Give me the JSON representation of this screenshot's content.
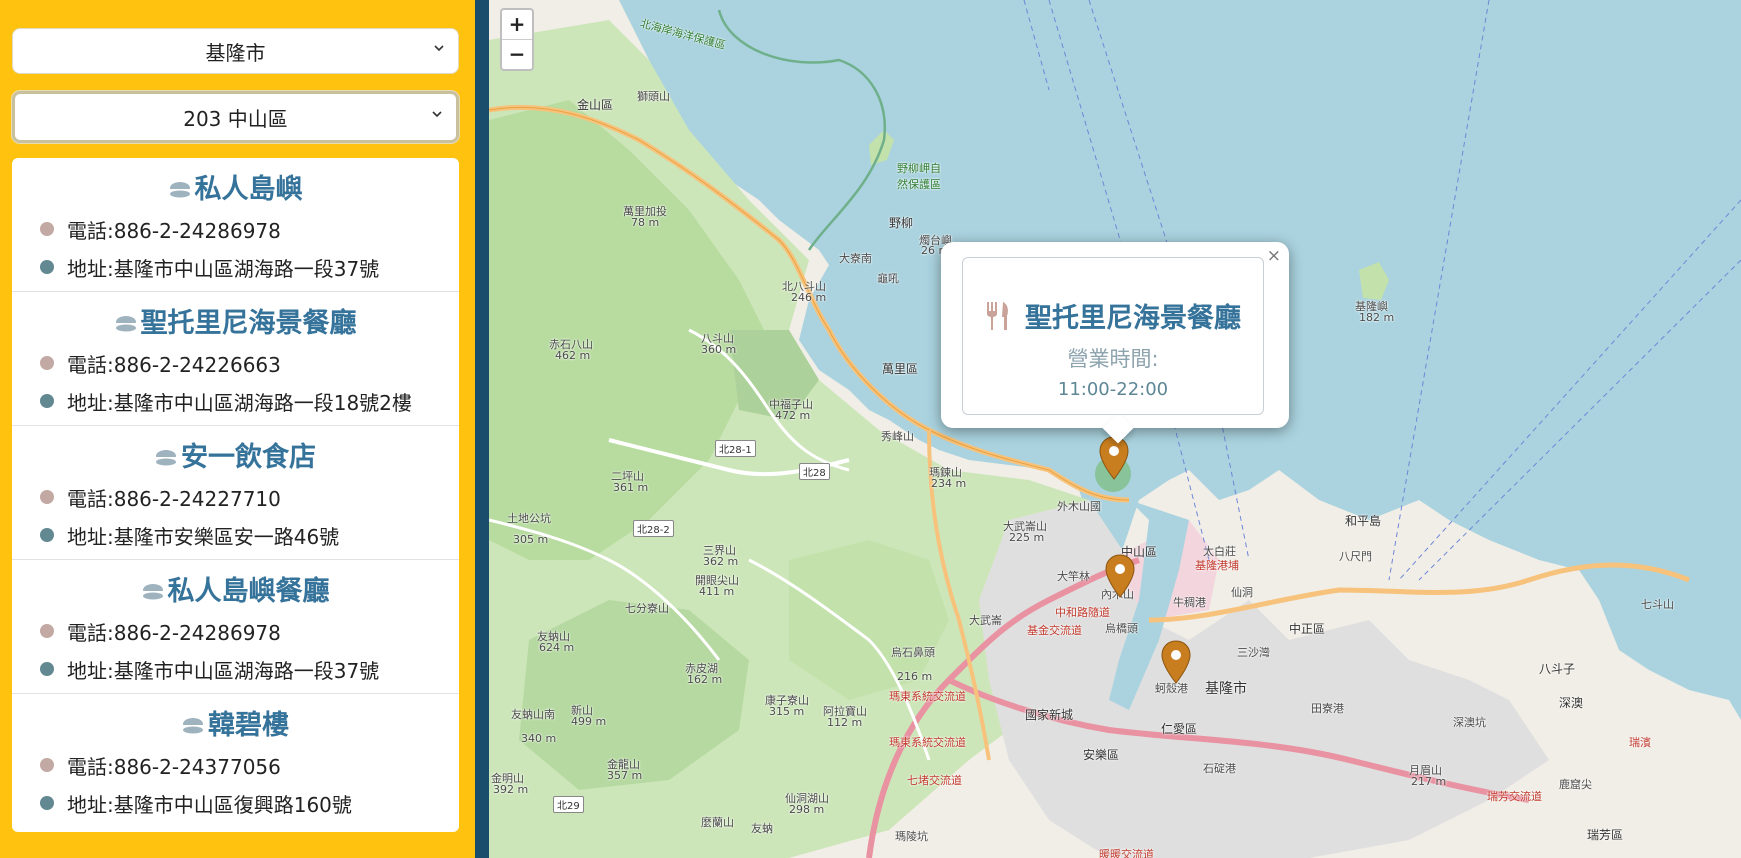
{
  "filters": {
    "city": "基隆市",
    "district": "203 中山區"
  },
  "stores": [
    {
      "name": "私人島嶼",
      "phone": "電話:886-2-24286978",
      "address": "地址:基隆市中山區湖海路一段37號"
    },
    {
      "name": "聖托里尼海景餐廳",
      "phone": "電話:886-2-24226663",
      "address": "地址:基隆市中山區湖海路一段18號2樓"
    },
    {
      "name": "安一飲食店",
      "phone": "電話:886-2-24227710",
      "address": "地址:基隆市安樂區安一路46號"
    },
    {
      "name": "私人島嶼餐廳",
      "phone": "電話:886-2-24286978",
      "address": "地址:基隆市中山區湖海路一段37號"
    },
    {
      "name": "韓碧樓",
      "phone": "電話:886-2-24377056",
      "address": "地址:基隆市中山區復興路160號"
    }
  ],
  "map": {
    "zoom_in": "+",
    "zoom_out": "−",
    "popup": {
      "title": "聖托里尼海景餐廳",
      "hours_label": "營業時間:",
      "hours": "11:00-22:00",
      "close": "×"
    },
    "labels": {
      "l1": "北海岸海洋保護區",
      "l2": "金山區",
      "l3": "獅頭山",
      "l4": "萬里加投",
      "l5": "78 m",
      "l6": "野柳",
      "l7": "燭台嶼",
      "l8": "26 m",
      "l9": "野柳岬自然保護區",
      "l10": "大寮南",
      "l11": "龜吼",
      "l12": "北八斗山",
      "l13": "246 m",
      "l14": "赤石八山",
      "l15": "462 m",
      "l16": "八斗山",
      "l17": "360 m",
      "l18": "萬里區",
      "l19": "中福子山",
      "l20": "472 m",
      "l21": "秀峰山",
      "l22": "北28-1",
      "l23": "北28",
      "l24": "二坪山",
      "l25": "361 m",
      "l26": "瑪鋉山",
      "l27": "234 m",
      "l28": "土地公坑",
      "l29": "305 m",
      "l30": "北28-2",
      "l31": "三界山",
      "l32": "362 m",
      "l33": "外木山國",
      "l34": "大武崙山",
      "l35": "225 m",
      "l36": "中山區",
      "l37": "太白莊",
      "l38": "基隆港埔",
      "l39": "八尺門",
      "l40": "和平島",
      "l41": "基隆嶼",
      "l42": "182 m",
      "l43": "大竿林",
      "l44": "內木山",
      "l45": "牛稠港",
      "l46": "仙洞",
      "l47": "中和路隨道",
      "l48": "大武崙",
      "l49": "基金交流道",
      "l50": "烏橋頭",
      "l51": "中正區",
      "l52": "三沙灣",
      "l53": "八斗子",
      "l54": "七斗山",
      "l55": "開眼尖山",
      "l56": "411 m",
      "l57": "七分寮山",
      "l58": "友蚋山",
      "l59": "624 m",
      "l60": "赤皮湖",
      "l61": "162 m",
      "l62": "烏石鼻頭",
      "l63": "216 m",
      "l64": "瑪東系統交流道",
      "l65": "國家新城",
      "l66": "基隆市",
      "l67": "仁愛區",
      "l68": "安樂區",
      "l69": "田寮港",
      "l70": "深澳坑",
      "l71": "深澳",
      "l72": "瑞濱",
      "l73": "蚵殼港",
      "l74": "康子寮山",
      "l75": "315 m",
      "l76": "阿拉寶山",
      "l77": "112 m",
      "l78": "友蚋山南",
      "l79": "340 m",
      "l80": "新山",
      "l81": "499 m",
      "l82": "金龍山",
      "l83": "357 m",
      "l84": "金明山",
      "l85": "392 m",
      "l86": "仙洞湖山",
      "l87": "298 m",
      "l88": "七堵交流道",
      "l89": "瑪陵坑",
      "l90": "石碇港",
      "l91": "月眉山",
      "l92": "217 m",
      "l93": "瑞芳交流道",
      "l94": "瑞芳區",
      "l95": "鹿窟尖",
      "l96": "暖暖交流道",
      "l97": "北29",
      "l98": "友蚋",
      "l99": "麼蘭山",
      "l100": "瑪東系統交流道"
    }
  }
}
